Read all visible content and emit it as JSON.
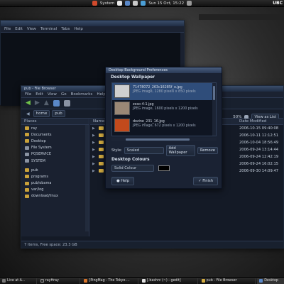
{
  "top_panel": {
    "system_label": "System",
    "clock": "Sun 15 Oct, 15:22",
    "corner_text": "UBC"
  },
  "terminal": {
    "menu": [
      "File",
      "Edit",
      "View",
      "Terminal",
      "Tabs",
      "Help"
    ]
  },
  "file_browser": {
    "title": "pub - File Browser",
    "menu": [
      "File",
      "Edit",
      "View",
      "Go",
      "Bookmarks",
      "Help"
    ],
    "location_buttons": [
      "home",
      "pub"
    ],
    "zoom": "50%",
    "view_mode": "View as List",
    "sidebar_header": "Places",
    "places": [
      "ray",
      "Documents",
      "Desktop",
      "File System",
      "PQSERVICE",
      "SYSTEM"
    ],
    "bookmarks": [
      "pub",
      "programs",
      "pub/obama",
      "var/log",
      "download/linux"
    ],
    "col_name": "Name",
    "col_modified": "Date Modified",
    "rows": [
      {
        "date": "2006-10-15 09:40:08"
      },
      {
        "date": "2006-10-11 12:12:51"
      },
      {
        "date": "2006-10-04 18:56:49"
      },
      {
        "date": "2006-09-24 13:14:44"
      },
      {
        "date": "2006-09-24 12:42:19"
      },
      {
        "date": "2006-09-24 16:02:15"
      },
      {
        "date": "2006-09-30 14:09:47"
      }
    ],
    "status": "7 items, Free space: 23.3 GB"
  },
  "dialog": {
    "title": "Desktop Background Preferences",
    "wallpaper_section": "Desktop Wallpaper",
    "wallpapers": [
      {
        "name": "71478072_263c16285f_o.jpg",
        "info": "JPEG image, 1280 pixels x 850 pixels",
        "thumb_color": "#cfcfcf"
      },
      {
        "name": "zoso-4-1.jpg",
        "info": "JPEG image, 1600 pixels x 1200 pixels",
        "thumb_color": "#9a8876"
      },
      {
        "name": "dozine_231_16.jpg",
        "info": "JPEG image, 672 pixels x 1200 pixels",
        "thumb_color": "#c24a1c"
      }
    ],
    "style_label": "Style:",
    "style_value": "Scaled",
    "add_wallpaper": "Add Wallpaper",
    "remove": "Remove",
    "colours_section": "Desktop Colours",
    "colour_mode": "Solid Colour",
    "help": "Help",
    "finish": "Finish"
  },
  "taskbar": {
    "items": [
      "Live at A...",
      "rayHray",
      "[PingMag - The Tokyo-...",
      "[.bashrc (~) - gedit]",
      "pub - File Browser",
      "Desktop"
    ]
  },
  "colors": {
    "accent": "#2f4d7a",
    "folder": "#d2ab40",
    "arrow_green": "#6fc14a"
  }
}
